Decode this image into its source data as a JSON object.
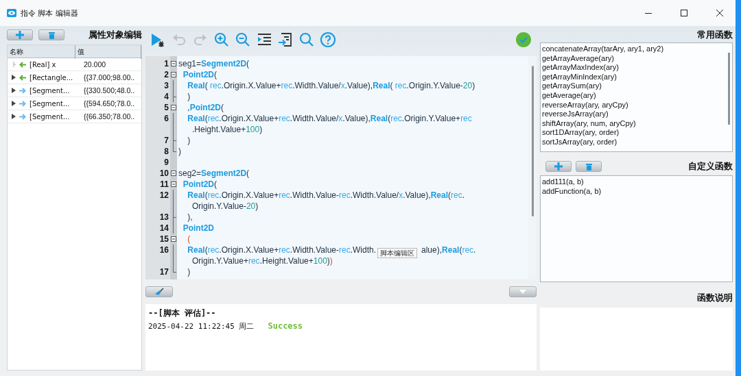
{
  "window": {
    "title": "指令 脚本 编辑器"
  },
  "properties": {
    "title": "属性对象编辑",
    "columns": [
      "名称",
      "值"
    ],
    "rows": [
      {
        "name": "[Real] x",
        "value": "20.000",
        "kind": "input",
        "expandable": false
      },
      {
        "name": "[Rectangle...",
        "value": "{{37.000;98.00..",
        "kind": "input",
        "expandable": true
      },
      {
        "name": "[Segment...",
        "value": "{{330.500;48.0..",
        "kind": "output",
        "expandable": true
      },
      {
        "name": "[Segment...",
        "value": "{{594.650;78.0..",
        "kind": "output",
        "expandable": true
      },
      {
        "name": "[Segment...",
        "value": "{{66.350;78.00..",
        "kind": "output",
        "expandable": true
      }
    ]
  },
  "toolbar": [
    {
      "kind": "run",
      "disabled": false
    },
    {
      "kind": "undo",
      "disabled": true
    },
    {
      "kind": "redo",
      "disabled": true
    },
    {
      "kind": "zoom-in",
      "disabled": false
    },
    {
      "kind": "zoom-out",
      "disabled": false
    },
    {
      "kind": "indent",
      "disabled": false
    },
    {
      "kind": "export",
      "disabled": false
    },
    {
      "kind": "search",
      "disabled": false
    },
    {
      "kind": "help",
      "disabled": false
    }
  ],
  "status": {
    "ok": true
  },
  "editor": {
    "tooltip": "脚本编辑区",
    "rows": [
      {
        "number": "1",
        "kind": "open",
        "tokens": [
          {
            "kind": "plain",
            "text": "seg1="
          },
          {
            "kind": "fn",
            "text": "Segment2D"
          },
          {
            "kind": "plain",
            "text": "("
          }
        ]
      },
      {
        "number": "2",
        "kind": "open",
        "tokens": [
          {
            "kind": "fn",
            "text": "  Point2D"
          },
          {
            "kind": "plain",
            "text": "("
          }
        ]
      },
      {
        "number": "3",
        "kind": "line",
        "tokens": [
          {
            "kind": "fn",
            "text": "    Real"
          },
          {
            "kind": "plain",
            "text": "( "
          },
          {
            "kind": "var",
            "text": "rec"
          },
          {
            "kind": "plain",
            "text": ".Origin.X.Value+"
          },
          {
            "kind": "var",
            "text": "rec"
          },
          {
            "kind": "plain",
            "text": ".Width.Value/"
          },
          {
            "kind": "var",
            "text": "x"
          },
          {
            "kind": "plain",
            "text": ".Value),"
          },
          {
            "kind": "fn",
            "text": "Real"
          },
          {
            "kind": "plain",
            "text": "( "
          },
          {
            "kind": "var",
            "text": "rec"
          },
          {
            "kind": "plain",
            "text": ".Origin.Y.Value-"
          },
          {
            "kind": "num",
            "text": "20"
          },
          {
            "kind": "plain",
            "text": ")"
          }
        ]
      },
      {
        "number": "4",
        "kind": "tick",
        "tokens": [
          {
            "kind": "plain",
            "text": "    )"
          }
        ]
      },
      {
        "number": "5",
        "kind": "open",
        "tokens": [
          {
            "kind": "plain",
            "text": "    ,"
          },
          {
            "kind": "fn",
            "text": "Point2D"
          },
          {
            "kind": "plain",
            "text": "("
          }
        ]
      },
      {
        "number": "6",
        "kind": "line",
        "tokens": [
          {
            "kind": "fn",
            "text": "    Real"
          },
          {
            "kind": "plain",
            "text": "("
          },
          {
            "kind": "var",
            "text": "rec"
          },
          {
            "kind": "plain",
            "text": ".Origin.X.Value+"
          },
          {
            "kind": "var",
            "text": "rec"
          },
          {
            "kind": "plain",
            "text": ".Width.Value/"
          },
          {
            "kind": "var",
            "text": "x"
          },
          {
            "kind": "plain",
            "text": ".Value),"
          },
          {
            "kind": "fn",
            "text": "Real"
          },
          {
            "kind": "plain",
            "text": "("
          },
          {
            "kind": "var",
            "text": "rec"
          },
          {
            "kind": "plain",
            "text": ".Origin.Y.Value+"
          },
          {
            "kind": "var",
            "text": "rec"
          }
        ]
      },
      {
        "kind": "line",
        "tokens": [
          {
            "kind": "plain",
            "text": "      .Height.Value+"
          },
          {
            "kind": "num",
            "text": "100"
          },
          {
            "kind": "plain",
            "text": ")"
          }
        ]
      },
      {
        "number": "7",
        "kind": "tick",
        "tokens": [
          {
            "kind": "plain",
            "text": "    )"
          }
        ]
      },
      {
        "number": "8",
        "kind": "end",
        "tokens": [
          {
            "kind": "plain",
            "text": ")"
          }
        ]
      },
      {
        "number": "9",
        "kind": "none",
        "tokens": []
      },
      {
        "number": "10",
        "kind": "open",
        "tokens": [
          {
            "kind": "plain",
            "text": "seg2="
          },
          {
            "kind": "fn",
            "text": "Segment2D"
          },
          {
            "kind": "plain",
            "text": "("
          }
        ]
      },
      {
        "number": "11",
        "kind": "open",
        "tokens": [
          {
            "kind": "fn",
            "text": "  Point2D"
          },
          {
            "kind": "plain",
            "text": "("
          }
        ]
      },
      {
        "number": "12",
        "kind": "line",
        "tokens": [
          {
            "kind": "fn",
            "text": "    Real"
          },
          {
            "kind": "plain",
            "text": "("
          },
          {
            "kind": "var",
            "text": "rec"
          },
          {
            "kind": "plain",
            "text": ".Origin.X.Value+"
          },
          {
            "kind": "var",
            "text": "rec"
          },
          {
            "kind": "plain",
            "text": ".Width.Value-"
          },
          {
            "kind": "var",
            "text": "rec"
          },
          {
            "kind": "plain",
            "text": ".Width.Value/"
          },
          {
            "kind": "var",
            "text": "x"
          },
          {
            "kind": "plain",
            "text": ".Value),"
          },
          {
            "kind": "fn",
            "text": "Real"
          },
          {
            "kind": "plain",
            "text": "("
          },
          {
            "kind": "var",
            "text": "rec"
          },
          {
            "kind": "plain",
            "text": "."
          }
        ]
      },
      {
        "kind": "line",
        "tokens": [
          {
            "kind": "plain",
            "text": "      Origin.Y.Value-"
          },
          {
            "kind": "num",
            "text": "20"
          },
          {
            "kind": "plain",
            "text": ")"
          }
        ]
      },
      {
        "number": "13",
        "kind": "tick",
        "tokens": [
          {
            "kind": "plain",
            "text": "    ),"
          }
        ]
      },
      {
        "number": "14",
        "kind": "line",
        "tokens": [
          {
            "kind": "fn",
            "text": "  Point2D"
          }
        ]
      },
      {
        "number": "15",
        "kind": "open",
        "tokens": [
          {
            "kind": "match",
            "text": "    ("
          }
        ]
      },
      {
        "number": "16",
        "kind": "line",
        "tokens": [
          {
            "kind": "fn",
            "text": "    Real"
          },
          {
            "kind": "plain",
            "text": "("
          },
          {
            "kind": "var",
            "text": "rec"
          },
          {
            "kind": "plain",
            "text": ".Origin.X.Value+"
          },
          {
            "kind": "var",
            "text": "rec"
          },
          {
            "kind": "plain",
            "text": ".Width.Value-"
          },
          {
            "kind": "var",
            "text": "rec"
          },
          {
            "kind": "plain",
            "text": ".Width."
          },
          {
            "kind": "tooltip"
          },
          {
            "kind": "plain",
            "text": "alue),"
          },
          {
            "kind": "fn",
            "text": "Real"
          },
          {
            "kind": "plain",
            "text": "("
          },
          {
            "kind": "var",
            "text": "rec"
          },
          {
            "kind": "plain",
            "text": "."
          }
        ]
      },
      {
        "kind": "line",
        "tokens": [
          {
            "kind": "plain",
            "text": "      Origin.Y.Value+"
          },
          {
            "kind": "var",
            "text": "rec"
          },
          {
            "kind": "plain",
            "text": ".Height.Value+"
          },
          {
            "kind": "num",
            "text": "100"
          },
          {
            "kind": "plain",
            "text": ")"
          },
          {
            "kind": "match",
            "text": ")"
          }
        ]
      },
      {
        "number": "17",
        "kind": "end",
        "tokens": [
          {
            "kind": "plain",
            "text": "    )"
          }
        ]
      }
    ]
  },
  "output": {
    "header": "--[脚本 评估]--",
    "timestamp": "2025-04-22 11:22:45 周二",
    "result": "Success"
  },
  "common_functions": {
    "title": "常用函数",
    "items": [
      "concatenateArray(tarAry, ary1, ary2)",
      "getArrayAverage(ary)",
      "getArrayMaxIndex(ary)",
      "getArrayMinIndex(ary)",
      "getArraySum(ary)",
      "getAverage(ary)",
      "reverseArray(ary, aryCpy)",
      "reverseJsArray(ary)",
      "shiftArray(ary, num, aryCpy)",
      "sort1DArray(ary, order)",
      "sortJsArray(ary, order)"
    ]
  },
  "custom_functions": {
    "title": "自定义函数",
    "items": [
      "add111(a, b)",
      "addFunction(a, b)"
    ]
  },
  "description": {
    "title": "函数说明"
  }
}
